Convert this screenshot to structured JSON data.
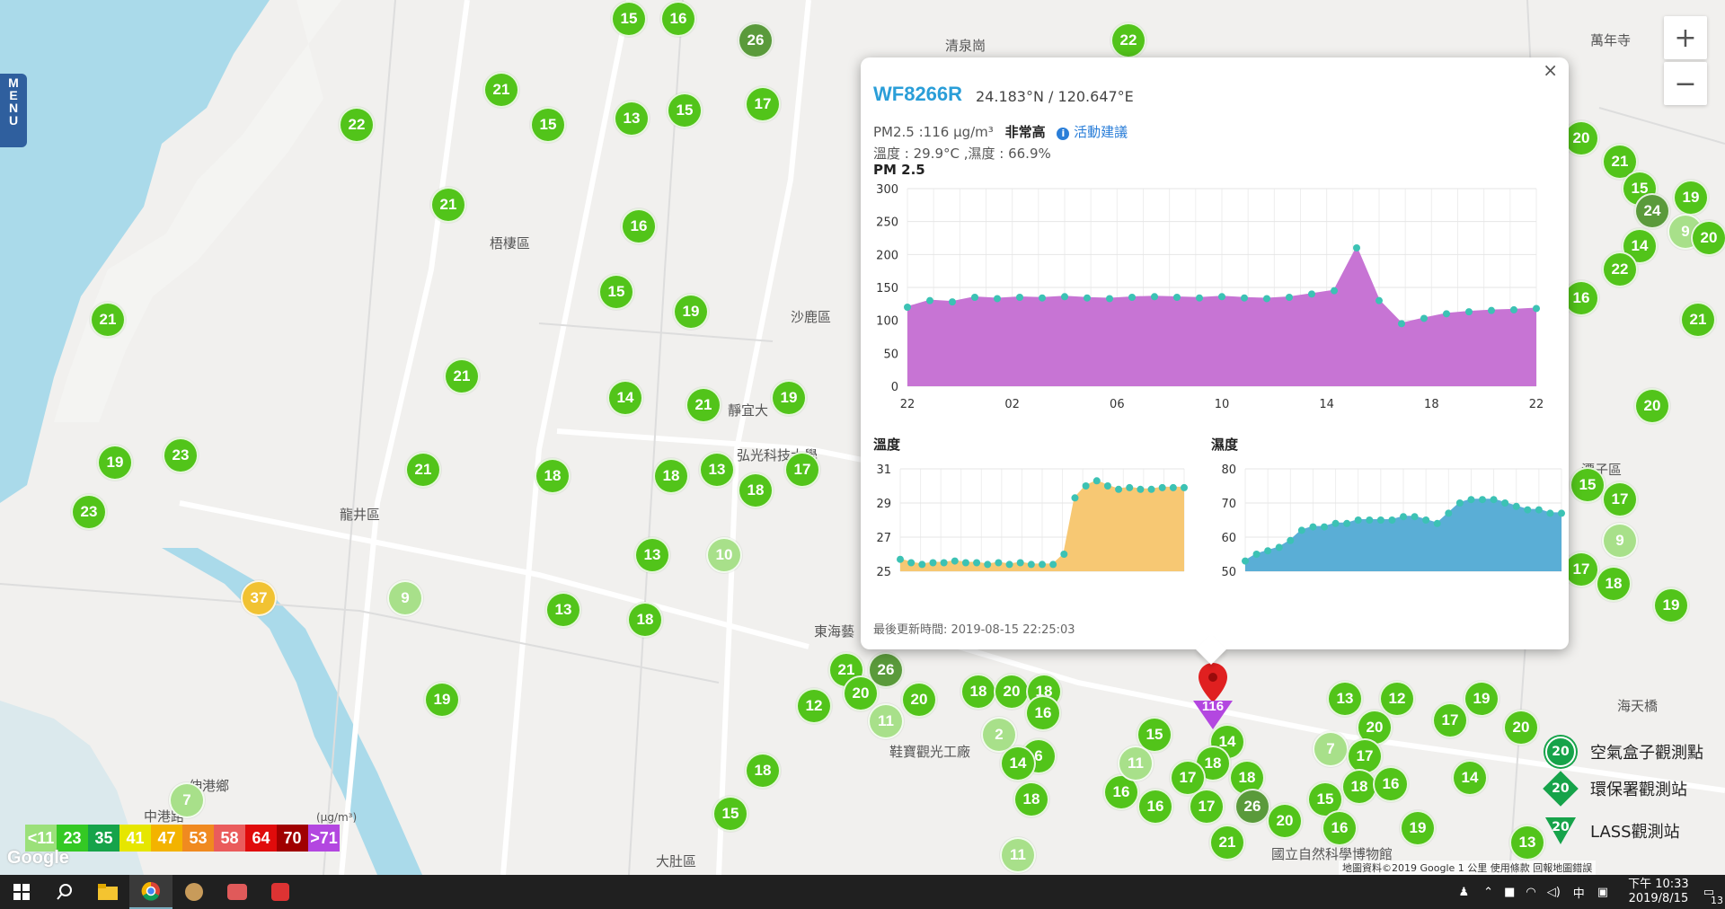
{
  "map": {
    "labels": [
      {
        "t": "梧棲區",
        "x": 545,
        "y": 260
      },
      {
        "t": "沙鹿區",
        "x": 880,
        "y": 342
      },
      {
        "t": "龍井區",
        "x": 378,
        "y": 562
      },
      {
        "t": "伸港鄉",
        "x": 210,
        "y": 864
      },
      {
        "t": "東海藝",
        "x": 906,
        "y": 692
      },
      {
        "t": "弘光科技大學",
        "x": 820,
        "y": 496
      },
      {
        "t": "靜宜大",
        "x": 810,
        "y": 446
      },
      {
        "t": "大肚區",
        "x": 730,
        "y": 948
      },
      {
        "t": "鞋寶觀光工廠",
        "x": 990,
        "y": 826
      },
      {
        "t": "潭子區",
        "x": 1760,
        "y": 512
      },
      {
        "t": "海天橋",
        "x": 1800,
        "y": 775
      },
      {
        "t": "國立自然科學博物館",
        "x": 1415,
        "y": 940
      },
      {
        "t": "萬年寺",
        "x": 1770,
        "y": 34
      },
      {
        "t": "中港路",
        "x": 160,
        "y": 898
      },
      {
        "t": "清泉崗",
        "x": 1052,
        "y": 40
      }
    ],
    "markers": [
      {
        "v": "15",
        "x": 700,
        "y": 21,
        "c": "g"
      },
      {
        "v": "16",
        "x": 755,
        "y": 21,
        "c": "g"
      },
      {
        "v": "26",
        "x": 841,
        "y": 45,
        "c": "dg"
      },
      {
        "v": "22",
        "x": 1256,
        "y": 45,
        "c": "g"
      },
      {
        "v": "21",
        "x": 558,
        "y": 100,
        "c": "g"
      },
      {
        "v": "22",
        "x": 397,
        "y": 139,
        "c": "g"
      },
      {
        "v": "15",
        "x": 610,
        "y": 139,
        "c": "g"
      },
      {
        "v": "13",
        "x": 703,
        "y": 132,
        "c": "g"
      },
      {
        "v": "15",
        "x": 762,
        "y": 123,
        "c": "g"
      },
      {
        "v": "17",
        "x": 849,
        "y": 116,
        "c": "g"
      },
      {
        "v": "21",
        "x": 499,
        "y": 228,
        "c": "g"
      },
      {
        "v": "16",
        "x": 711,
        "y": 252,
        "c": "g"
      },
      {
        "v": "15",
        "x": 686,
        "y": 325,
        "c": "g"
      },
      {
        "v": "19",
        "x": 769,
        "y": 347,
        "c": "g"
      },
      {
        "v": "21",
        "x": 120,
        "y": 356,
        "c": "g"
      },
      {
        "v": "21",
        "x": 514,
        "y": 419,
        "c": "g"
      },
      {
        "v": "14",
        "x": 696,
        "y": 443,
        "c": "g"
      },
      {
        "v": "21",
        "x": 783,
        "y": 451,
        "c": "g"
      },
      {
        "v": "19",
        "x": 878,
        "y": 443,
        "c": "g"
      },
      {
        "v": "19",
        "x": 128,
        "y": 515,
        "c": "g"
      },
      {
        "v": "23",
        "x": 201,
        "y": 507,
        "c": "g"
      },
      {
        "v": "21",
        "x": 471,
        "y": 523,
        "c": "g"
      },
      {
        "v": "18",
        "x": 615,
        "y": 530,
        "c": "g"
      },
      {
        "v": "18",
        "x": 747,
        "y": 530,
        "c": "g"
      },
      {
        "v": "13",
        "x": 798,
        "y": 523,
        "c": "g"
      },
      {
        "v": "18",
        "x": 841,
        "y": 546,
        "c": "g"
      },
      {
        "v": "17",
        "x": 893,
        "y": 523,
        "c": "g"
      },
      {
        "v": "23",
        "x": 99,
        "y": 570,
        "c": "g"
      },
      {
        "v": "13",
        "x": 726,
        "y": 618,
        "c": "g"
      },
      {
        "v": "10",
        "x": 806,
        "y": 618,
        "c": "lg"
      },
      {
        "v": "37",
        "x": 288,
        "y": 666,
        "c": "y"
      },
      {
        "v": "9",
        "x": 451,
        "y": 666,
        "c": "lg"
      },
      {
        "v": "13",
        "x": 627,
        "y": 679,
        "c": "g"
      },
      {
        "v": "18",
        "x": 718,
        "y": 690,
        "c": "g"
      },
      {
        "v": "19",
        "x": 492,
        "y": 779,
        "c": "g"
      },
      {
        "v": "7",
        "x": 208,
        "y": 891,
        "c": "lg"
      },
      {
        "v": "18",
        "x": 849,
        "y": 858,
        "c": "g"
      },
      {
        "v": "15",
        "x": 813,
        "y": 906,
        "c": "g"
      },
      {
        "v": "21",
        "x": 942,
        "y": 746,
        "c": "g"
      },
      {
        "v": "26",
        "x": 986,
        "y": 746,
        "c": "dg"
      },
      {
        "v": "12",
        "x": 906,
        "y": 786,
        "c": "g"
      },
      {
        "v": "20",
        "x": 958,
        "y": 772,
        "c": "g"
      },
      {
        "v": "11",
        "x": 986,
        "y": 803,
        "c": "lg"
      },
      {
        "v": "20",
        "x": 1023,
        "y": 779,
        "c": "g"
      },
      {
        "v": "18",
        "x": 1089,
        "y": 770,
        "c": "g"
      },
      {
        "v": "20",
        "x": 1126,
        "y": 770,
        "c": "g"
      },
      {
        "v": "18",
        "x": 1162,
        "y": 770,
        "c": "g"
      },
      {
        "v": "16",
        "x": 1161,
        "y": 794,
        "c": "g"
      },
      {
        "v": "2",
        "x": 1112,
        "y": 818,
        "c": "lg"
      },
      {
        "v": "6",
        "x": 1156,
        "y": 842,
        "c": "g"
      },
      {
        "v": "14",
        "x": 1133,
        "y": 850,
        "c": "g"
      },
      {
        "v": "18",
        "x": 1148,
        "y": 890,
        "c": "g"
      },
      {
        "v": "11",
        "x": 1133,
        "y": 952,
        "c": "lg"
      },
      {
        "v": "15",
        "x": 1285,
        "y": 818,
        "c": "g"
      },
      {
        "v": "14",
        "x": 1366,
        "y": 826,
        "c": "g"
      },
      {
        "v": "18",
        "x": 1350,
        "y": 850,
        "c": "g"
      },
      {
        "v": "17",
        "x": 1322,
        "y": 866,
        "c": "g"
      },
      {
        "v": "18",
        "x": 1388,
        "y": 866,
        "c": "g"
      },
      {
        "v": "16",
        "x": 1248,
        "y": 882,
        "c": "g"
      },
      {
        "v": "16",
        "x": 1286,
        "y": 898,
        "c": "g"
      },
      {
        "v": "17",
        "x": 1343,
        "y": 898,
        "c": "g"
      },
      {
        "v": "26",
        "x": 1394,
        "y": 898,
        "c": "dg"
      },
      {
        "v": "20",
        "x": 1430,
        "y": 914,
        "c": "g"
      },
      {
        "v": "21",
        "x": 1366,
        "y": 938,
        "c": "g"
      },
      {
        "v": "11",
        "x": 1264,
        "y": 850,
        "c": "lg"
      },
      {
        "v": "13",
        "x": 1497,
        "y": 778,
        "c": "g"
      },
      {
        "v": "12",
        "x": 1555,
        "y": 778,
        "c": "g"
      },
      {
        "v": "19",
        "x": 1649,
        "y": 778,
        "c": "g"
      },
      {
        "v": "17",
        "x": 1614,
        "y": 802,
        "c": "g"
      },
      {
        "v": "20",
        "x": 1530,
        "y": 810,
        "c": "g"
      },
      {
        "v": "7",
        "x": 1481,
        "y": 834,
        "c": "lg"
      },
      {
        "v": "17",
        "x": 1519,
        "y": 842,
        "c": "g"
      },
      {
        "v": "20",
        "x": 1693,
        "y": 810,
        "c": "g"
      },
      {
        "v": "18",
        "x": 1513,
        "y": 876,
        "c": "g"
      },
      {
        "v": "16",
        "x": 1548,
        "y": 873,
        "c": "g"
      },
      {
        "v": "15",
        "x": 1475,
        "y": 890,
        "c": "g"
      },
      {
        "v": "16",
        "x": 1491,
        "y": 922,
        "c": "g"
      },
      {
        "v": "19",
        "x": 1578,
        "y": 922,
        "c": "g"
      },
      {
        "v": "14",
        "x": 1636,
        "y": 866,
        "c": "g"
      },
      {
        "v": "13",
        "x": 1700,
        "y": 938,
        "c": "g"
      },
      {
        "v": "20",
        "x": 1760,
        "y": 154,
        "c": "g"
      },
      {
        "v": "21",
        "x": 1803,
        "y": 180,
        "c": "g"
      },
      {
        "v": "15",
        "x": 1825,
        "y": 210,
        "c": "g"
      },
      {
        "v": "24",
        "x": 1839,
        "y": 235,
        "c": "dg"
      },
      {
        "v": "19",
        "x": 1882,
        "y": 220,
        "c": "g"
      },
      {
        "v": "9",
        "x": 1876,
        "y": 258,
        "c": "lg"
      },
      {
        "v": "20",
        "x": 1902,
        "y": 265,
        "c": "g"
      },
      {
        "v": "14",
        "x": 1825,
        "y": 274,
        "c": "g"
      },
      {
        "v": "22",
        "x": 1803,
        "y": 300,
        "c": "g"
      },
      {
        "v": "16",
        "x": 1760,
        "y": 332,
        "c": "g"
      },
      {
        "v": "21",
        "x": 1890,
        "y": 356,
        "c": "g"
      },
      {
        "v": "20",
        "x": 1839,
        "y": 452,
        "c": "g"
      },
      {
        "v": "15",
        "x": 1767,
        "y": 540,
        "c": "g"
      },
      {
        "v": "17",
        "x": 1803,
        "y": 556,
        "c": "g"
      },
      {
        "v": "9",
        "x": 1803,
        "y": 602,
        "c": "lg"
      },
      {
        "v": "17",
        "x": 1760,
        "y": 634,
        "c": "g"
      },
      {
        "v": "18",
        "x": 1796,
        "y": 650,
        "c": "g"
      },
      {
        "v": "19",
        "x": 1860,
        "y": 674,
        "c": "g"
      }
    ]
  },
  "menu": "MENU",
  "zoom": {
    "in": "+",
    "out": "−"
  },
  "popup": {
    "station": "WF8266R",
    "coords": "24.183°N / 120.647°E",
    "pm_text": "PM2.5 :116 μg/m³",
    "level": "非常高",
    "advice": "活動建議",
    "temp_humid": "溫度 : 29.9°C ,濕度 : 66.9%",
    "chart_title": "PM 2.5",
    "temp_title": "溫度",
    "humid_title": "濕度",
    "updated": "最後更新時間: 2019-08-15 22:25:03",
    "close": "×"
  },
  "chart_data": [
    {
      "type": "area",
      "title": "PM 2.5",
      "x": [
        "22",
        "",
        "",
        "",
        "02",
        "",
        "",
        "",
        "06",
        "",
        "",
        "",
        "10",
        "",
        "",
        "",
        "14",
        "",
        "",
        "",
        "18",
        "",
        "",
        "",
        "22"
      ],
      "x_ticks": [
        "22",
        "02",
        "06",
        "10",
        "14",
        "18",
        "22"
      ],
      "ylim": [
        0,
        300
      ],
      "yticks": [
        0,
        50,
        100,
        150,
        200,
        250,
        300
      ],
      "color": "#c774d4",
      "values": [
        120,
        130,
        128,
        135,
        133,
        135,
        134,
        136,
        134,
        133,
        135,
        136,
        135,
        134,
        136,
        134,
        133,
        135,
        140,
        145,
        210,
        130,
        95,
        103,
        110,
        113,
        115,
        116,
        118
      ]
    },
    {
      "type": "area",
      "title": "溫度",
      "ylim": [
        25,
        31
      ],
      "yticks": [
        25,
        27,
        29,
        31
      ],
      "color": "#f7c873",
      "values": [
        25.7,
        25.5,
        25.4,
        25.5,
        25.5,
        25.6,
        25.5,
        25.5,
        25.4,
        25.5,
        25.4,
        25.5,
        25.4,
        25.4,
        25.4,
        26.0,
        29.3,
        30.0,
        30.3,
        30.0,
        29.8,
        29.9,
        29.8,
        29.8,
        29.9,
        29.9,
        29.9
      ]
    },
    {
      "type": "area",
      "title": "濕度",
      "ylim": [
        50,
        80
      ],
      "yticks": [
        50,
        60,
        70,
        80
      ],
      "color": "#5aaed6",
      "values": [
        53,
        55,
        56,
        57,
        59,
        62,
        63,
        63,
        64,
        64,
        65,
        65,
        65,
        65,
        66,
        66,
        65,
        64,
        67,
        70,
        71,
        71,
        71,
        70,
        69,
        68,
        68,
        67,
        67
      ]
    }
  ],
  "legend": {
    "unit": "(μg/m³)",
    "items": [
      {
        "t": "<11",
        "c": "#9be07a"
      },
      {
        "t": "23",
        "c": "#34c924"
      },
      {
        "t": "35",
        "c": "#16a34a"
      },
      {
        "t": "41",
        "c": "#e6e600"
      },
      {
        "t": "47",
        "c": "#f3b300"
      },
      {
        "t": "53",
        "c": "#f08a20"
      },
      {
        "t": "58",
        "c": "#ea5c5c"
      },
      {
        "t": "64",
        "c": "#e00b0b"
      },
      {
        "t": "70",
        "c": "#a00000"
      },
      {
        "t": ">71",
        "c": "#b347e0"
      }
    ]
  },
  "stations": [
    {
      "label": "空氣盒子觀測點",
      "badge": "20"
    },
    {
      "label": "環保署觀測站",
      "badge": "20"
    },
    {
      "label": "LASS觀測站",
      "badge": "20"
    }
  ],
  "attribution": "地圖資料©2019 Google   1 公里        使用條款    回報地圖錯誤",
  "google": "Google",
  "pin_value": "116",
  "taskbar": {
    "time": "下午 10:33",
    "date": "2019/8/15",
    "notif": "13",
    "ime": "中"
  }
}
